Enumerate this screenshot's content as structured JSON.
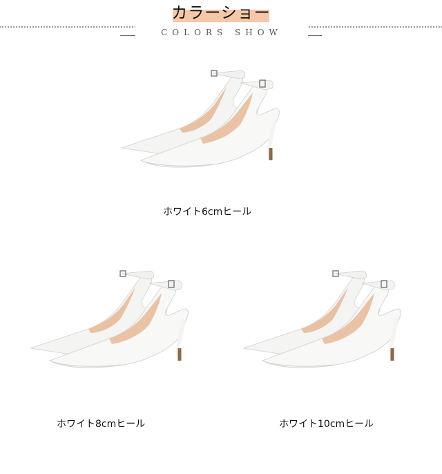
{
  "header": {
    "title": "カラーショー",
    "subtitle": "COLORS SHOW"
  },
  "products": [
    {
      "label": "ホワイト6cmヒール"
    },
    {
      "label": "ホワイト8cmヒール"
    },
    {
      "label": "ホワイト10cmヒール"
    }
  ],
  "colors": {
    "title_highlight": "#f7c8a8",
    "shoe_white": "#f7f7f5",
    "shoe_lining": "#e9c2a5",
    "heel_tip": "#8a6a4a"
  }
}
